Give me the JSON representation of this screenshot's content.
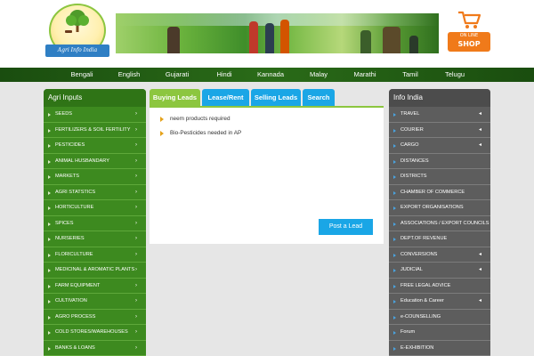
{
  "header": {
    "logo_text": "Agri Info India",
    "shop_small": "ON LINE",
    "shop_big": "SHOP"
  },
  "languages": [
    "Bengali",
    "English",
    "Gujarati",
    "Hindi",
    "Kannada",
    "Malay",
    "Marathi",
    "Tamil",
    "Telugu"
  ],
  "left_panel": {
    "title": "Agri Inputs",
    "items": [
      {
        "label": "SEEDS",
        "submenu": true
      },
      {
        "label": "FERTILIZERS & SOIL FERTILITY",
        "submenu": true
      },
      {
        "label": "PESTICIDES",
        "submenu": true
      },
      {
        "label": "ANIMAL HUSBANDARY",
        "submenu": true
      },
      {
        "label": "MARKETS",
        "submenu": true
      },
      {
        "label": "AGRI STATSTICS",
        "submenu": true
      },
      {
        "label": "HORTICULTURE",
        "submenu": true
      },
      {
        "label": "SPICES",
        "submenu": true
      },
      {
        "label": "NURSERIES",
        "submenu": true
      },
      {
        "label": "FLORICULTURE",
        "submenu": true
      },
      {
        "label": "MEDICINAL & AROMATIC PLANTS",
        "submenu": true
      },
      {
        "label": "FARM EQUIPMENT",
        "submenu": true
      },
      {
        "label": "CULTIVATION",
        "submenu": true
      },
      {
        "label": "AGRO PROCESS",
        "submenu": true
      },
      {
        "label": "COLD STORES/WAREHOUSES",
        "submenu": true
      },
      {
        "label": "BANKS & LOANS",
        "submenu": true
      }
    ]
  },
  "tabs": [
    {
      "label": "Buying Leads",
      "active": true
    },
    {
      "label": "Lease/Rent",
      "active": false
    },
    {
      "label": "Selling Leads",
      "active": false
    },
    {
      "label": "Search",
      "active": false
    }
  ],
  "leads": [
    "neem products required",
    "Bio-Pesticides needed in AP"
  ],
  "post_button": "Post a Lead",
  "right_panel": {
    "title": "Info India",
    "items": [
      {
        "label": "TRAVEL",
        "submenu": true
      },
      {
        "label": "COURIER",
        "submenu": true
      },
      {
        "label": "CARGO",
        "submenu": true
      },
      {
        "label": "DISTANCES",
        "submenu": false
      },
      {
        "label": "DISTRICTS",
        "submenu": false
      },
      {
        "label": "CHAMBER OF COMMERCE",
        "submenu": false
      },
      {
        "label": "EXPORT ORGANISATIONS",
        "submenu": false
      },
      {
        "label": "ASSOCIATIONS / EXPORT COUNCILS",
        "submenu": false
      },
      {
        "label": "DEPT.OF REVENUE",
        "submenu": false
      },
      {
        "label": "CONVERSIONS",
        "submenu": true
      },
      {
        "label": "JUDICIAL",
        "submenu": true
      },
      {
        "label": "FREE LEGAL ADVICE",
        "submenu": false
      },
      {
        "label": "Education & Career",
        "submenu": true
      },
      {
        "label": "e-COUNSELLING",
        "submenu": false
      },
      {
        "label": "Forum",
        "submenu": false
      },
      {
        "label": "E-EXHIBITION",
        "submenu": false
      }
    ]
  },
  "colors": {
    "green_dark": "#2f7416",
    "green": "#3d8a1f",
    "green_light": "#8cc63f",
    "blue": "#1aa6e6",
    "gray": "#5d5d5d",
    "orange": "#f07a1a"
  }
}
